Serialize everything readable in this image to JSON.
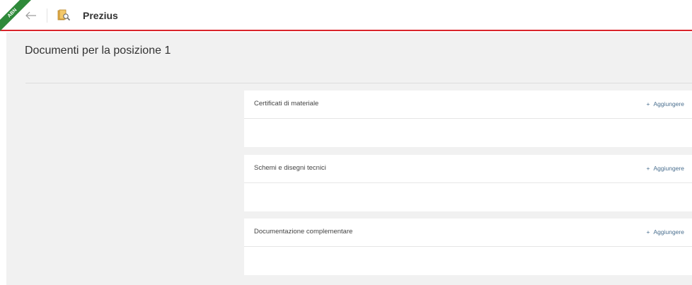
{
  "header": {
    "ribbon_text": "ABN",
    "app_title": "Prezius",
    "accent_color": "#d9252b",
    "ribbon_color": "#2f8a3a"
  },
  "page": {
    "title": "Documenti per la posizione 1"
  },
  "sections": [
    {
      "title": "Certificati di materiale",
      "add_label": "Aggiungere",
      "add_icon": "+"
    },
    {
      "title": "Schemi e disegni tecnici",
      "add_label": "Aggiungere",
      "add_icon": "+"
    },
    {
      "title": "Documentazione complementare",
      "add_label": "Aggiungere",
      "add_icon": "+"
    }
  ],
  "icons": {
    "back": "arrow-left-icon",
    "app": "document-search-icon"
  }
}
